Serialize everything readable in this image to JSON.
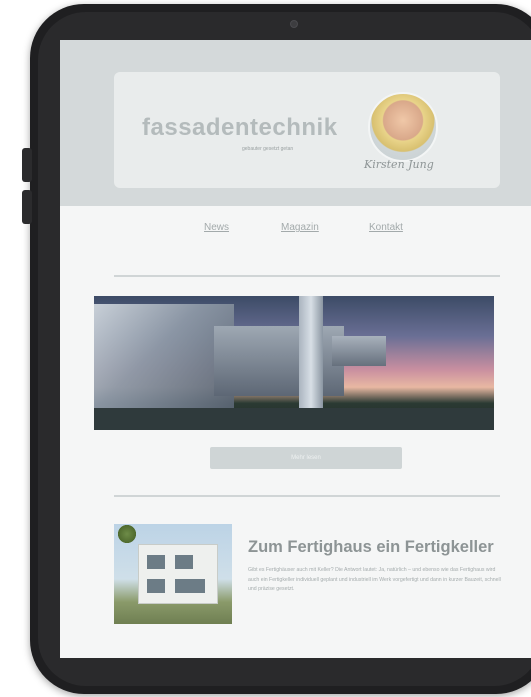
{
  "header": {
    "logo": "fassadentechnik",
    "tagline": "gebauter gesetzt getan",
    "signature": "Kirsten Jung"
  },
  "nav": {
    "items": [
      {
        "label": "News"
      },
      {
        "label": "Magazin"
      },
      {
        "label": "Kontakt"
      }
    ]
  },
  "hero": {
    "button_label": "Mehr lesen"
  },
  "article": {
    "title": "Zum Fertighaus ein Fertigkeller",
    "body": "Gibt es Fertighäuser auch mit Keller? Die Antwort lautet: Ja, natürlich – und ebenso wie das Fertighaus wird auch ein Fertigkeller individuell geplant und industriell im Werk vorgefertigt und dann in kurzer Bauzeit, schnell und präzise gesetzt."
  }
}
